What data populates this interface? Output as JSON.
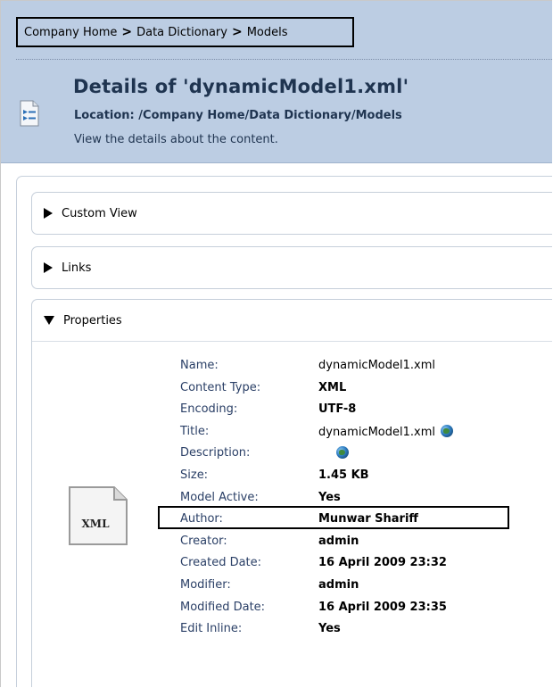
{
  "breadcrumb": {
    "items": [
      "Company Home",
      "Data Dictionary",
      "Models"
    ],
    "separator": ">"
  },
  "header": {
    "title": "Details of 'dynamicModel1.xml'",
    "location": "Location: /Company Home/Data Dictionary/Models",
    "subtitle": "View the details about the content."
  },
  "panels": {
    "custom_view": "Custom View",
    "links": "Links",
    "properties": "Properties"
  },
  "file_icon": {
    "label": "XML"
  },
  "properties": [
    {
      "label": "Name:",
      "value": "dynamicModel1.xml",
      "bold": false,
      "globe": false
    },
    {
      "label": "Content Type:",
      "value": "XML",
      "bold": true,
      "globe": false
    },
    {
      "label": "Encoding:",
      "value": "UTF-8",
      "bold": true,
      "globe": false
    },
    {
      "label": "Title:",
      "value": "dynamicModel1.xml",
      "bold": false,
      "globe": true
    },
    {
      "label": "Description:",
      "value": "",
      "bold": false,
      "globe": true
    },
    {
      "label": "Size:",
      "value": "1.45 KB",
      "bold": true,
      "globe": false
    },
    {
      "label": "Model Active:",
      "value": "Yes",
      "bold": true,
      "globe": false
    },
    {
      "label": "Author:",
      "value": "Munwar Shariff",
      "bold": true,
      "globe": false
    },
    {
      "label": "Creator:",
      "value": "admin",
      "bold": true,
      "globe": false
    },
    {
      "label": "Created Date:",
      "value": "16 April 2009 23:32",
      "bold": true,
      "globe": false
    },
    {
      "label": "Modifier:",
      "value": "admin",
      "bold": true,
      "globe": false
    },
    {
      "label": "Modified Date:",
      "value": "16 April 2009 23:35",
      "bold": true,
      "globe": false
    },
    {
      "label": "Edit Inline:",
      "value": "Yes",
      "bold": true,
      "globe": false
    }
  ],
  "colors": {
    "header_bg": "#bccde3",
    "title_text": "#1f3450",
    "label_text": "#2a3f66"
  }
}
